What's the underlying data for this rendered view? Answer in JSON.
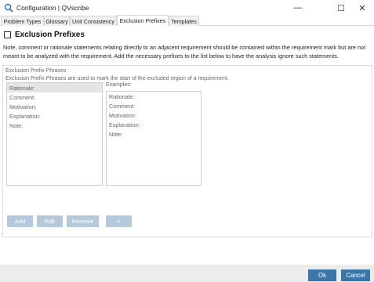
{
  "window": {
    "title": "Configuration | QVscribe",
    "minimize_glyph": "—",
    "maximize_glyph": "☐",
    "close_glyph": "✕"
  },
  "tabs": [
    {
      "label": "Problem Types",
      "active": false
    },
    {
      "label": "Glossary",
      "active": false
    },
    {
      "label": "Unit Consistency",
      "active": false
    },
    {
      "label": "Exclusion Prefixes",
      "active": true
    },
    {
      "label": "Templates",
      "active": false
    }
  ],
  "main": {
    "heading": "Exclusion Prefixes",
    "checked": false,
    "description": "Note, comment or rationale statements relating directly to an adjacent requirement should be contained within the requirement mark but are not meant to be analyzed with the requirement. Add the necessary prefixes to the list below to have the analysis ignore such statements."
  },
  "group": {
    "legend": "Exclusion Prefix Phrases",
    "description": "Exclusion Prefix Phrases are used to mark the start of the excluded region of a requirement.",
    "prefix_list": [
      "Rationale:",
      "Comment:",
      "Motivation:",
      "Explanation:",
      "Note:"
    ],
    "selected_index": 0,
    "examples_label": "Examples:",
    "examples_list": [
      "Rationale:",
      "Comment:",
      "Motivation:",
      "Explanation:",
      "Note:"
    ],
    "buttons": {
      "add": "Add",
      "edit": "Edit",
      "remove": "Remove",
      "back": "<"
    }
  },
  "footer": {
    "ok": "Ok",
    "cancel": "Cancel"
  },
  "colors": {
    "primary_button": "#3a77a8",
    "disabled_button": "#b5c9dd",
    "selected_row": "#e5e5e5"
  }
}
